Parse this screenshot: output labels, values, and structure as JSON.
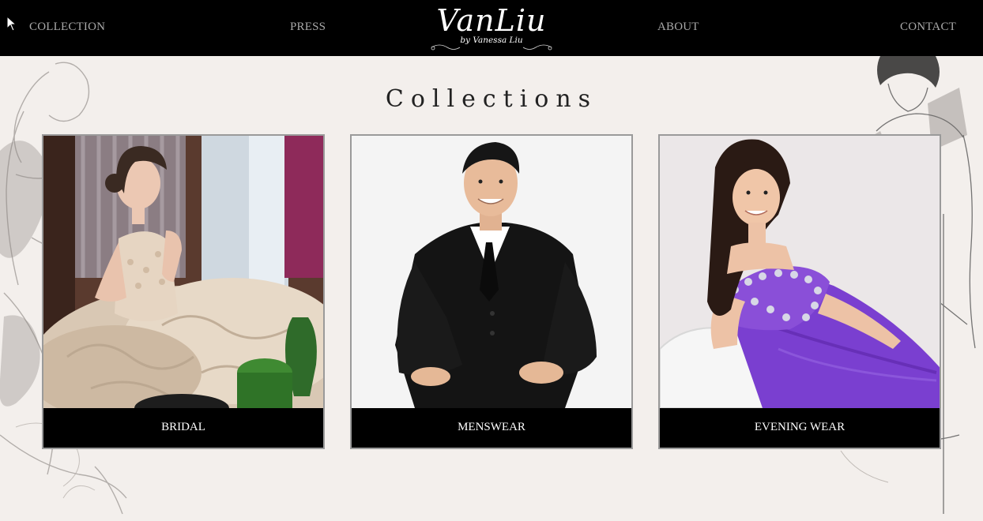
{
  "nav": {
    "items": [
      {
        "label": "COLLECTION"
      },
      {
        "label": "PRESS"
      },
      {
        "label": "ABOUT"
      },
      {
        "label": "CONTACT"
      }
    ],
    "logo": {
      "main": "VanLiu",
      "sub": "by Vanessa Liu"
    }
  },
  "main": {
    "title": "Collections",
    "cards": [
      {
        "label": "BRIDAL",
        "photo": "bride-in-ivory-gown"
      },
      {
        "label": "MENSWEAR",
        "photo": "man-in-black-suit"
      },
      {
        "label": "EVENING WEAR",
        "photo": "woman-in-purple-gown"
      }
    ]
  },
  "colors": {
    "nav_bg": "#000000",
    "nav_text": "#a9a9a9",
    "page_bg": "#f3efec",
    "card_border": "#9a9a9a",
    "label_bg": "#000000",
    "label_text": "#ffffff",
    "evening_gown": "#7a3fd0"
  }
}
